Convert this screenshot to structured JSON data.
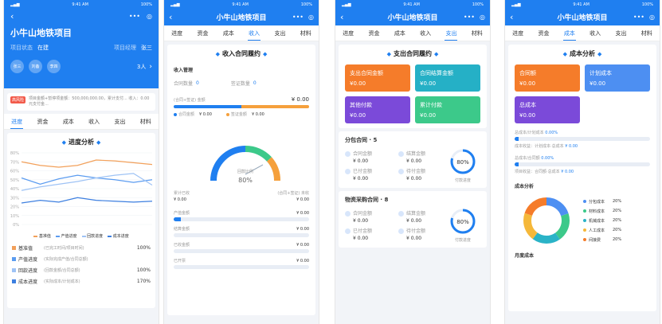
{
  "status": {
    "time": "9:41 AM",
    "battery": "100%"
  },
  "project_title": "小牛山地铁项目",
  "tabs": [
    "进度",
    "资金",
    "成本",
    "收入",
    "支出",
    "材料"
  ],
  "p1": {
    "title": "小牛山地铁项目",
    "state_label": "项目状态",
    "state_value": "在建",
    "manager_label": "项目经理",
    "manager_value": "张三",
    "avatars": [
      "张三",
      "刘备",
      "李四"
    ],
    "member_count": "3人",
    "risk_badge": "高风险",
    "risk_text": "项目金额+暂停项金额：500,000,000.00，累计支付... 收入：0.00元支付金...",
    "section_title": "进度分析",
    "chart_ticks": [
      "80%",
      "70%",
      "60%",
      "50%",
      "40%",
      "30%",
      "20%",
      "10%",
      "0%"
    ],
    "legend": [
      "基准值",
      "产值进度",
      "回款进度",
      "成本进度"
    ],
    "table": [
      {
        "name": "基准值",
        "desc": "(已完工时间/项目时间)",
        "value": "100%"
      },
      {
        "name": "产值进度",
        "desc": "(实际完成产值/合同总额)",
        "value": ""
      },
      {
        "name": "回款进度",
        "desc": "(回款金额/合同总额)",
        "value": "100%"
      },
      {
        "name": "成本进度",
        "desc": "(实际成本/计划成本)",
        "value": "170%"
      }
    ],
    "colors": {
      "base": "#f2a05a",
      "prod": "#5b9cf0",
      "collect": "#9ec3f5",
      "cost": "#3d7fe0"
    }
  },
  "chart_data": {
    "type": "line",
    "series": [
      {
        "name": "基准值",
        "values": [
          70,
          66,
          64,
          66,
          72,
          71,
          69,
          67
        ]
      },
      {
        "name": "产值进度",
        "values": [
          52,
          45,
          51,
          55,
          52,
          50,
          47,
          50
        ]
      },
      {
        "name": "回款进度",
        "values": [
          38,
          42,
          45,
          48,
          52,
          55,
          57,
          44
        ]
      },
      {
        "name": "成本进度",
        "values": [
          24,
          27,
          25,
          30,
          27,
          26,
          25,
          26
        ]
      }
    ],
    "ylim": [
      0,
      80
    ]
  },
  "p2": {
    "section_title": "收入合同履约",
    "mgmt_title": "收入管理",
    "contract_count_label": "合同数量",
    "contract_count": "0",
    "contract_amount_label": "签证数量",
    "contract_amount": "0",
    "top_label": "(合同+签证) 金额",
    "top_value": "¥ 0.00",
    "legend_a": "合同金额",
    "legend_a_val": "¥ 0.00",
    "legend_b": "签证金额",
    "legend_b_val": "¥ 0.00",
    "gauge_label": "回款比例",
    "gauge_value": "80%",
    "left_label": "累计已收",
    "left_value": "¥ 0.00",
    "right_label": "(合同+签证) 未收",
    "right_value": "¥ 0.00",
    "rows": [
      {
        "label": "产值金额",
        "value": "¥ 0.00",
        "fill": 0.05
      },
      {
        "label": "结算金额",
        "value": "¥ 0.00",
        "fill": 0.0
      },
      {
        "label": "已收金额",
        "value": "¥ 0.00",
        "fill": 0.0
      },
      {
        "label": "已开票",
        "value": "¥ 0.00",
        "fill": 0.0
      }
    ]
  },
  "p3": {
    "section_title": "支出合同履约",
    "tiles": [
      {
        "label": "支出合同金额",
        "value": "¥0.00",
        "color": "#f57c2a"
      },
      {
        "label": "合同结算金额",
        "value": "¥0.00",
        "color": "#25b0c6"
      },
      {
        "label": "其他付款",
        "value": "¥0.00",
        "color": "#7b4ad9"
      },
      {
        "label": "累计付款",
        "value": "¥0.00",
        "color": "#3cc98a"
      }
    ],
    "sub_title": "分包合同 · 5",
    "sub_items": [
      {
        "label": "合同金额",
        "value": "¥ 0.00"
      },
      {
        "label": "结算金额",
        "value": "¥ 0.00"
      },
      {
        "label": "已付金额",
        "value": "¥ 0.00"
      },
      {
        "label": "待付金额",
        "value": "¥ 0.00"
      }
    ],
    "sub_ring": "80%",
    "sub_ring_label": "付款进度",
    "mat_title": "物资采购合同 · 8",
    "mat_items": [
      {
        "label": "合同金额",
        "value": "¥ 0.00"
      },
      {
        "label": "结算金额",
        "value": "¥ 0.00"
      },
      {
        "label": "已付金额",
        "value": "¥ 0.00"
      },
      {
        "label": "待付金额",
        "value": "¥ 0.00"
      }
    ],
    "mat_ring": "80%",
    "mat_ring_label": "付款进度"
  },
  "p4": {
    "section_title": "成本分析",
    "tiles": [
      {
        "label": "合同额",
        "value": "¥0.00",
        "color": "#f57c2a"
      },
      {
        "label": "计划成本",
        "value": "¥0.00",
        "color": "#4d8ff2"
      },
      {
        "label": "总成本",
        "value": "¥0.00",
        "color": "#7b4ad9"
      }
    ],
    "r1_label": "总成本/计划成本",
    "r1_value": "0.00%",
    "r2_a": "成本收益：计划成本·总成本",
    "r2_b": "¥ 0.00",
    "r3_label": "总成本/合同额",
    "r3_value": "0.00%",
    "r4_a": "项目收益：合同额·总成本",
    "r4_b": "¥ 0.00",
    "donut_title": "成本分析",
    "donut": [
      {
        "name": "分包成本",
        "value": "20%",
        "color": "#4d8ff2"
      },
      {
        "name": "材料成本",
        "value": "20%",
        "color": "#3cc98a"
      },
      {
        "name": "机械成本",
        "value": "20%",
        "color": "#2ab3c7"
      },
      {
        "name": "人工成本",
        "value": "20%",
        "color": "#f5b83a"
      },
      {
        "name": "间接费",
        "value": "20%",
        "color": "#f57c2a"
      }
    ],
    "footer": "月度成本"
  }
}
